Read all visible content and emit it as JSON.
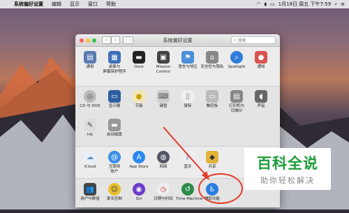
{
  "menubar": {
    "apple": "",
    "items": [
      "系统偏好设置",
      "编辑",
      "显示",
      "窗口",
      "帮助"
    ],
    "clock": "1月18日 周五 下午7:59"
  },
  "window": {
    "title": "系统偏好设置",
    "search_placeholder": "搜索"
  },
  "sections": {
    "row1": [
      "通用",
      "桌面与\n屏幕保护程序",
      "Dock",
      "Mission\nControl",
      "语言与地区",
      "安全性与隐私",
      "Spotlight",
      "通知"
    ],
    "row2a": [
      "CD 与 DVD",
      "显示器",
      "节能",
      "键盘",
      "鼠标",
      "触控板",
      "打印机与\n扫描仪",
      "声音"
    ],
    "row2b": [
      "Ink",
      "启动磁盘"
    ],
    "row3": [
      "iCloud",
      "互联网\n帐户",
      "App Store",
      "网络",
      "蓝牙",
      "共享"
    ],
    "row4": [
      "用户与群组",
      "家长控制",
      "Siri",
      "日期与时间",
      "Time Machine",
      "辅助功能"
    ]
  },
  "brand": {
    "big": "百科全说",
    "small": "助你轻松解决"
  },
  "colors": {
    "annotation": "#e23b2e",
    "brand_green": "#1e9c3a"
  }
}
